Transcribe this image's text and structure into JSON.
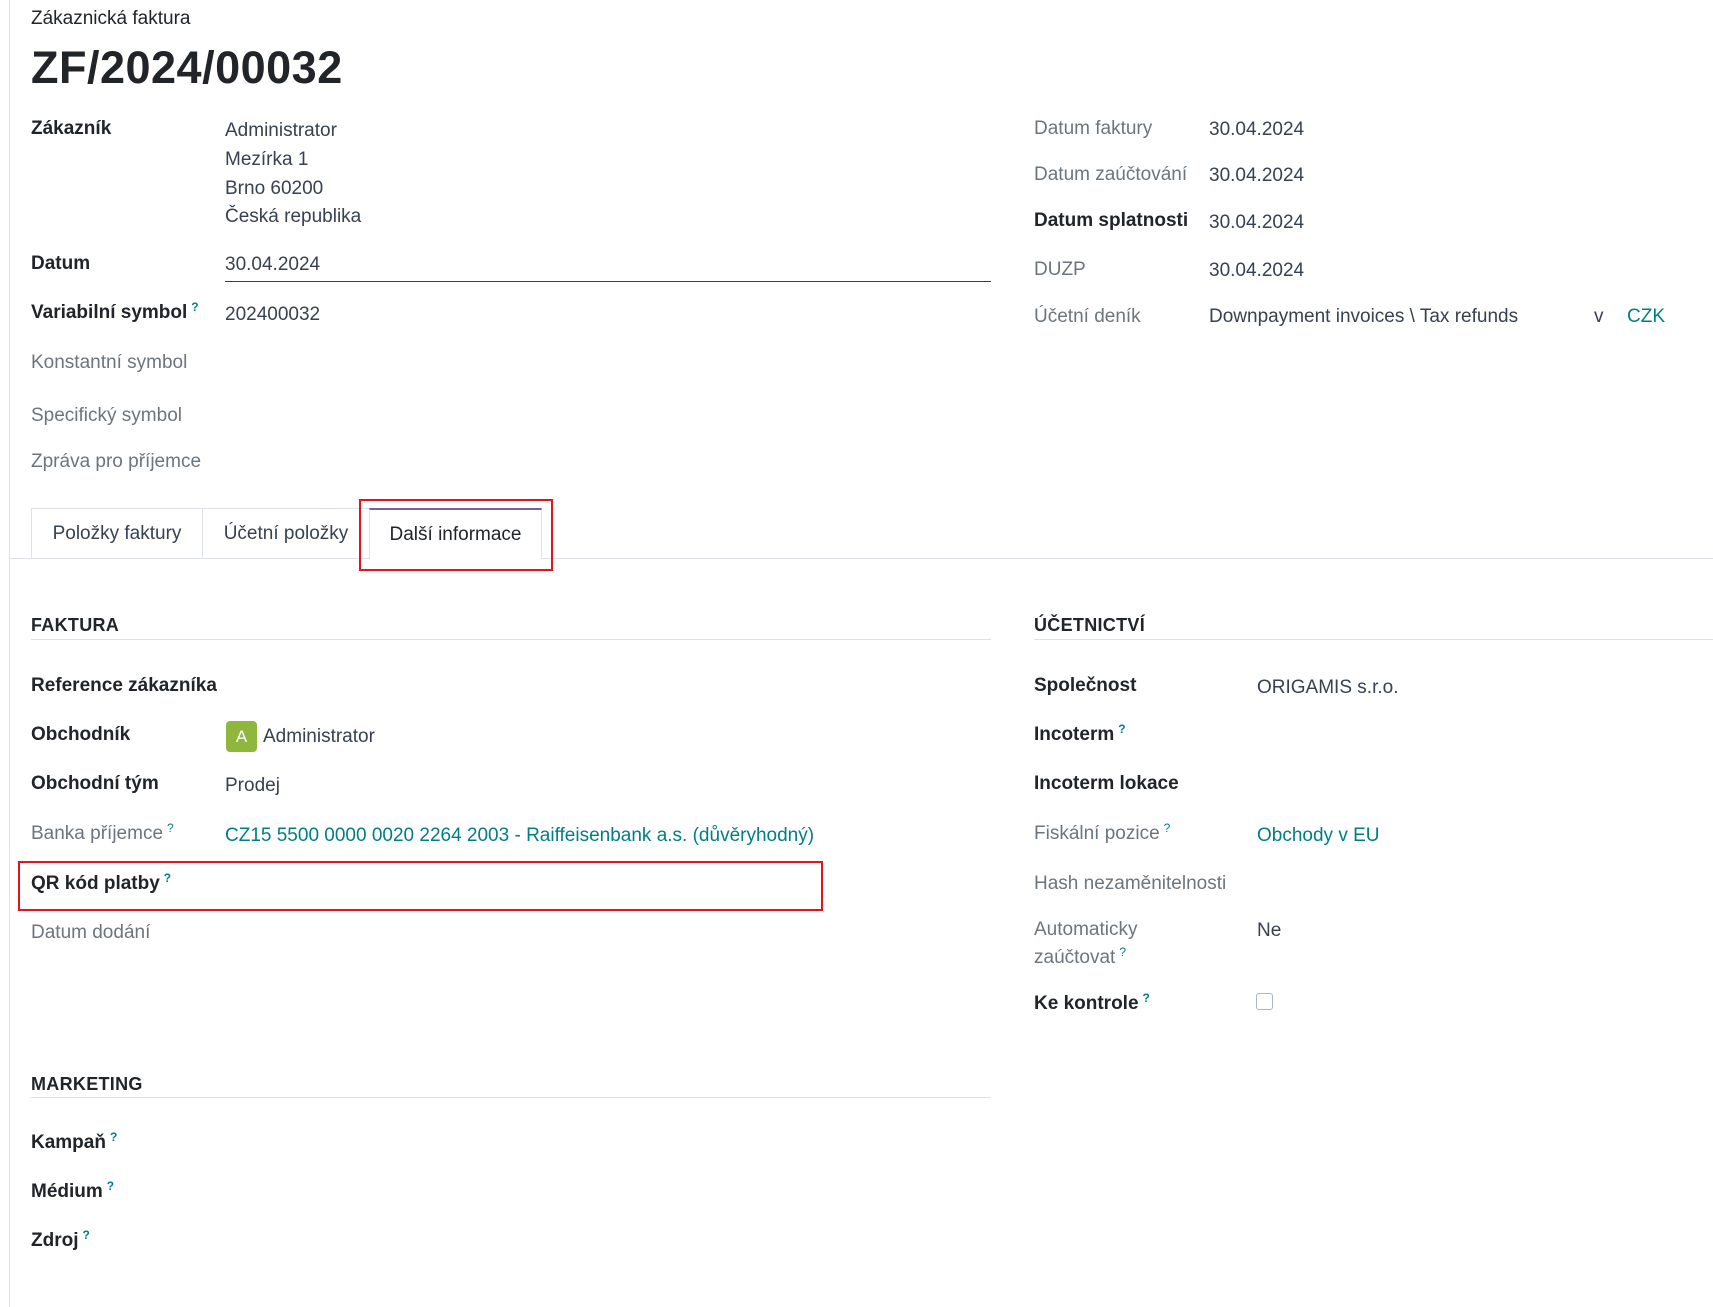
{
  "header": {
    "doc_type": "Zákaznická faktura",
    "doc_number": "ZF/2024/00032"
  },
  "partner": {
    "label": "Zákazník",
    "address": [
      "Administrator",
      "Mezírka 1",
      "Brno 60200",
      "Česká republika"
    ]
  },
  "left_fields": {
    "date_label": "Datum",
    "date_value": "30.04.2024",
    "vs_label": "Variabilní symbol",
    "vs_value": "202400032",
    "ks_label": "Konstantní symbol",
    "ss_label": "Specifický symbol",
    "msg_label": "Zpráva pro příjemce"
  },
  "right_fields": {
    "invoice_date_label": "Datum faktury",
    "invoice_date_value": "30.04.2024",
    "acc_date_label": "Datum zaúčtování",
    "acc_date_value": "30.04.2024",
    "due_date_label": "Datum splatnosti",
    "due_date_value": "30.04.2024",
    "duzp_label": "DUZP",
    "duzp_value": "30.04.2024",
    "journal_label": "Účetní deník",
    "journal_value": "Downpayment invoices \\ Tax refunds",
    "journal_in": "v",
    "currency": "CZK"
  },
  "tabs": [
    {
      "label": "Položky faktury"
    },
    {
      "label": "Účetní položky"
    },
    {
      "label": "Další informace",
      "active": true
    }
  ],
  "faktura": {
    "title": "FAKTURA",
    "customer_ref_label": "Reference zákazníka",
    "salesperson_label": "Obchodník",
    "salesperson_initial": "A",
    "salesperson_value": "Administrator",
    "team_label": "Obchodní tým",
    "team_value": "Prodej",
    "bank_label": "Banka příjemce",
    "bank_value": "CZ15 5500 0000 0020 2264 2003 - Raiffeisenbank a.s. (důvěryhodný)",
    "qr_label": "QR kód platby",
    "delivery_date_label": "Datum dodání"
  },
  "ucetnictvi": {
    "title": "ÚČETNICTVÍ",
    "company_label": "Společnost",
    "company_value": "ORIGAMIS s.r.o.",
    "incoterm_label": "Incoterm",
    "incoterm_loc_label": "Incoterm lokace",
    "fiscal_label": "Fiskální pozice",
    "fiscal_value": "Obchody v EU",
    "hash_label": "Hash nezaměnitelnosti",
    "auto_post_label_1": "Automaticky",
    "auto_post_label_2": "zaúčtovat",
    "auto_post_value": "Ne",
    "review_label": "Ke kontrole",
    "review_checked": false
  },
  "marketing": {
    "title": "MARKETING",
    "campaign_label": "Kampaň",
    "medium_label": "Médium",
    "source_label": "Zdroj"
  },
  "help_mark": "?",
  "colors": {
    "link": "#017e84",
    "highlight": "#e3131f",
    "avatar": "#8fb73e",
    "active_tab": "#71639e"
  }
}
